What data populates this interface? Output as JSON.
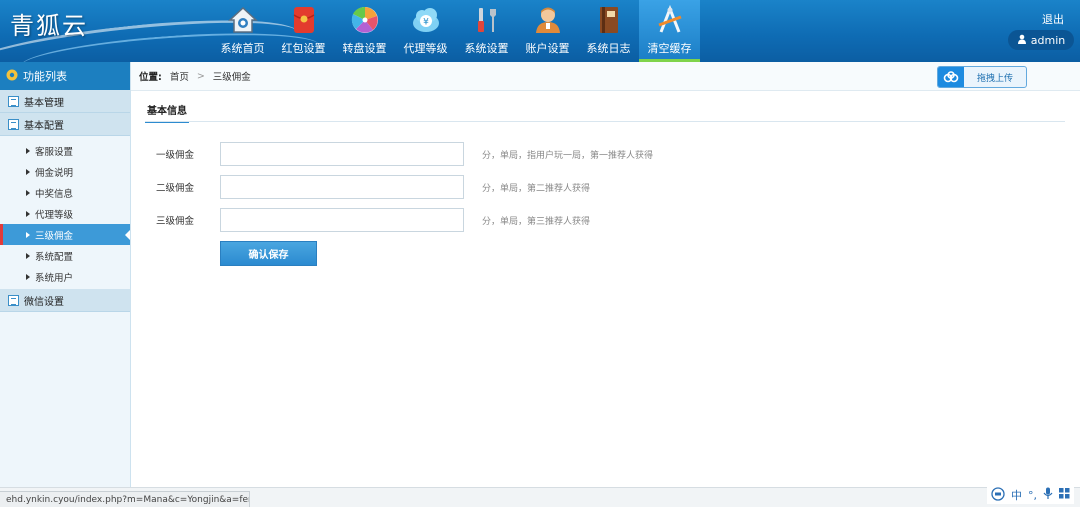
{
  "brand": {
    "logo_text": "青狐云"
  },
  "nav": {
    "items": [
      {
        "label": "系统首页",
        "icon": "home-icon"
      },
      {
        "label": "红包设置",
        "icon": "red-packet-icon"
      },
      {
        "label": "转盘设置",
        "icon": "wheel-icon"
      },
      {
        "label": "代理等级",
        "icon": "money-cloud-icon"
      },
      {
        "label": "系统设置",
        "icon": "tools-icon"
      },
      {
        "label": "账户设置",
        "icon": "user-account-icon"
      },
      {
        "label": "系统日志",
        "icon": "log-book-icon"
      },
      {
        "label": "清空缓存",
        "icon": "clear-cache-icon",
        "active": true
      }
    ],
    "logout_label": "退出",
    "user_label": "admin"
  },
  "sidebar": {
    "title": "功能列表",
    "groups": [
      {
        "label": "基本管理"
      },
      {
        "label": "基本配置"
      }
    ],
    "sub_items": [
      {
        "label": "客服设置"
      },
      {
        "label": "佣金说明"
      },
      {
        "label": "中奖信息"
      },
      {
        "label": "代理等级"
      },
      {
        "label": "三级佣金",
        "active": true
      },
      {
        "label": "系统配置"
      },
      {
        "label": "系统用户"
      }
    ],
    "last_group": {
      "label": "微信设置"
    }
  },
  "breadcrumb": {
    "prefix": "位置:",
    "home": "首页",
    "separator": ">",
    "current": "三级佣金"
  },
  "upload": {
    "label": "拖拽上传"
  },
  "section": {
    "tab_label": "基本信息"
  },
  "form": {
    "rows": [
      {
        "label": "一级佣金",
        "value": "",
        "hint": "分，单局，指用户玩一局，第一推荐人获得"
      },
      {
        "label": "二级佣金",
        "value": "",
        "hint": "分，单局，第二推荐人获得"
      },
      {
        "label": "三级佣金",
        "value": "",
        "hint": "分，单局，第三推荐人获得"
      }
    ],
    "save_label": "确认保存"
  },
  "status": {
    "url": "ehd.ynkin.cyou/index.php?m=Mana&c=Yongjin&a=fenxiao"
  },
  "ime": {
    "lang": "中",
    "dot": "°,",
    "mic": "mic-icon",
    "grid": "grid-icon"
  },
  "colors": {
    "header": "#0e6bb3",
    "accent": "#3d9ad8",
    "active_nav_bar": "#7fd34a"
  }
}
